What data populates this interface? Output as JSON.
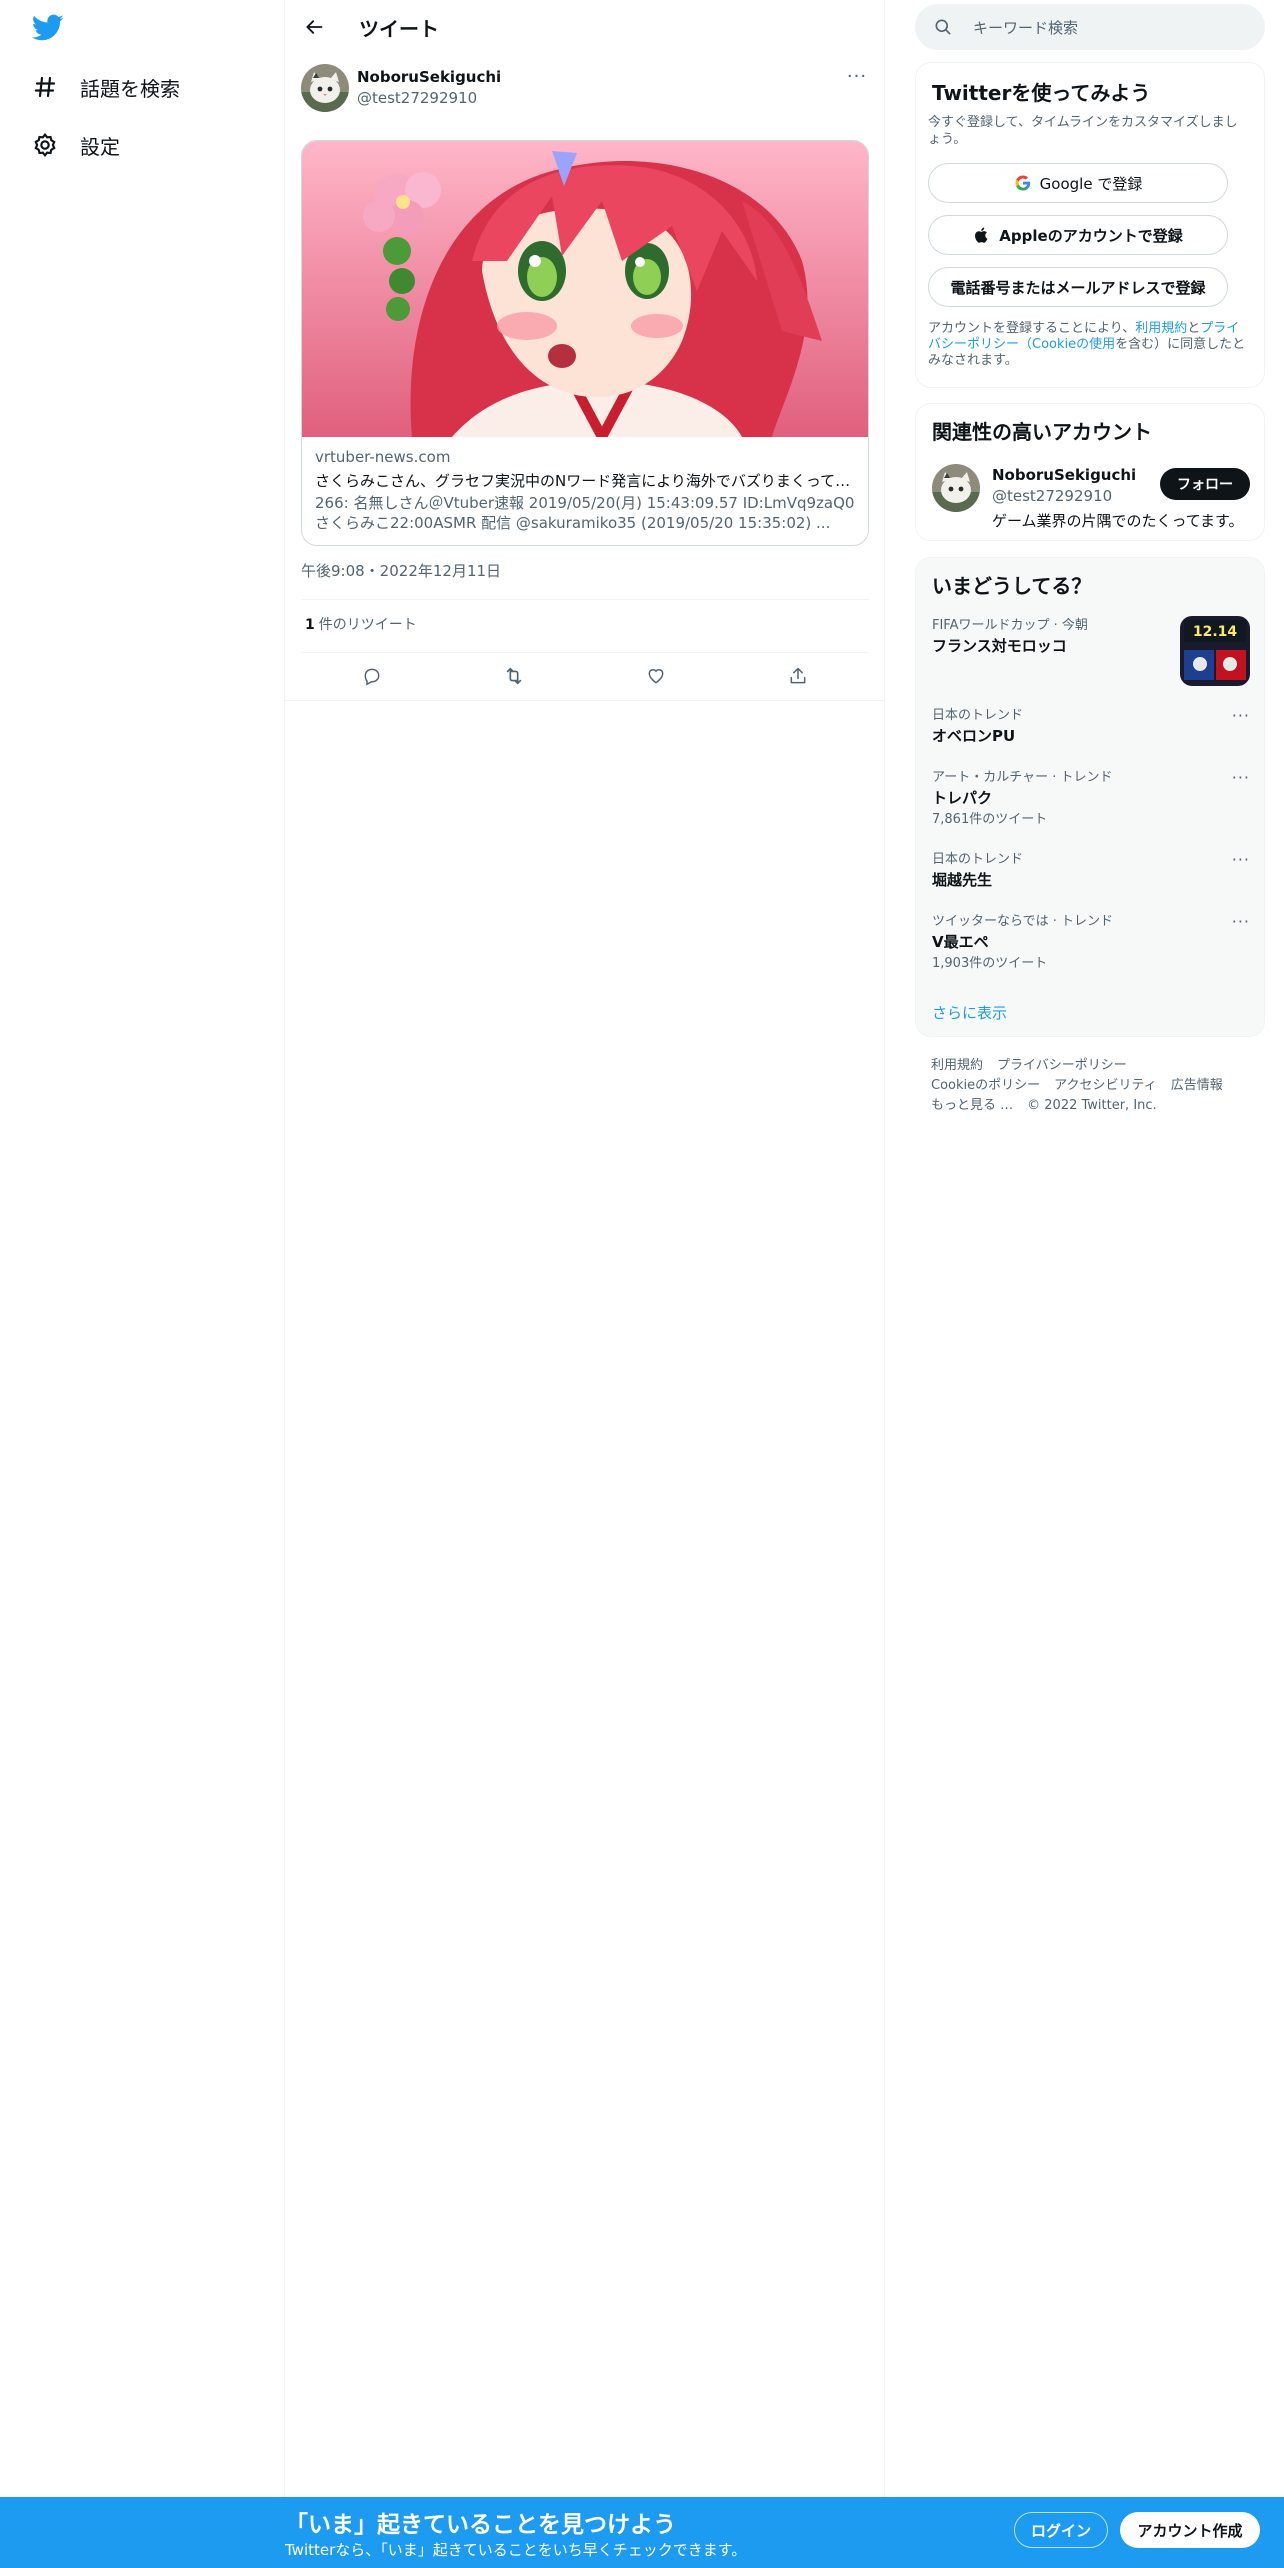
{
  "nav": {
    "logo": "twitter-bird",
    "items": [
      {
        "label": "話題を検索",
        "icon": "hashtag-icon"
      },
      {
        "label": "設定",
        "icon": "gear-icon"
      }
    ]
  },
  "header": {
    "title": "ツイート"
  },
  "tweet": {
    "author_name": "NoboruSekiguchi",
    "author_handle": "@test27292910",
    "more": "···",
    "card": {
      "domain": "vrtuber-news.com",
      "title": "さくらみこさん、グラセフ実況中のNワード発言により海外でバズりまくって…",
      "description": "266: 名無しさん＠Vtuber速報 2019/05/20(月) 15:43:09.57 ID:LmVq9zaQ0 さくらみこ22:00ASMR 配信 @sakuramiko35 (2019/05/20 15:35:02) ..."
    },
    "timestamp": "午後9:08・2022年12月11日",
    "retweet_count": "1",
    "retweet_label": "件のリツイート",
    "actions": [
      "reply-icon",
      "retweet-icon",
      "like-icon",
      "share-icon"
    ]
  },
  "search": {
    "placeholder": "キーワード検索"
  },
  "signup": {
    "title": "Twitterを使ってみよう",
    "subtitle": "今すぐ登録して、タイムラインをカスタマイズしましょう。",
    "google": "Google で登録",
    "apple": "Appleのアカウントで登録",
    "phone": "電話番号またはメールアドレスで登録",
    "legal_prefix": "アカウントを登録することにより、",
    "legal_terms": "利用規約",
    "legal_and": "と",
    "legal_privacy": "プライバシーポリシー",
    "legal_paren_open": "（",
    "legal_cookie": "Cookieの使用",
    "legal_suffix": "を含む）に同意したとみなされます。"
  },
  "related": {
    "title": "関連性の高いアカウント",
    "name": "NoboruSekiguchi",
    "handle": "@test27292910",
    "bio": "ゲーム業界の片隅でのたくってます。",
    "follow": "フォロー"
  },
  "trends": {
    "title": "いまどうしてる？",
    "items": [
      {
        "context": "FIFAワールドカップ · 今朝",
        "title": "フランス対モロッコ",
        "count": ""
      },
      {
        "context": "日本のトレンド",
        "title": "オベロンPU",
        "count": ""
      },
      {
        "context": "アート・カルチャー · トレンド",
        "title": "トレパク",
        "count": "7,861件のツイート"
      },
      {
        "context": "日本のトレンド",
        "title": "堀越先生",
        "count": ""
      },
      {
        "context": "ツイッターならでは · トレンド",
        "title": "V最エペ",
        "count": "1,903件のツイート"
      }
    ],
    "thumb_text": "12.14",
    "more_dots": "···",
    "show_more": "さらに表示"
  },
  "footer": {
    "terms": "利用規約",
    "privacy": "プライバシーポリシー",
    "cookie": "Cookieのポリシー",
    "accessibility": "アクセシビリティ",
    "ads": "広告情報",
    "more": "もっと見る …",
    "copyright": "© 2022 Twitter, Inc."
  },
  "banner": {
    "title": "「いま」起きていることを見つけよう",
    "subtitle": "Twitterなら、「いま」起きていることをいち早くチェックできます。",
    "login": "ログイン",
    "signup": "アカウント作成"
  },
  "colors": {
    "accent": "#1d9bf0",
    "text": "#0f1419",
    "secondary": "#536471"
  }
}
